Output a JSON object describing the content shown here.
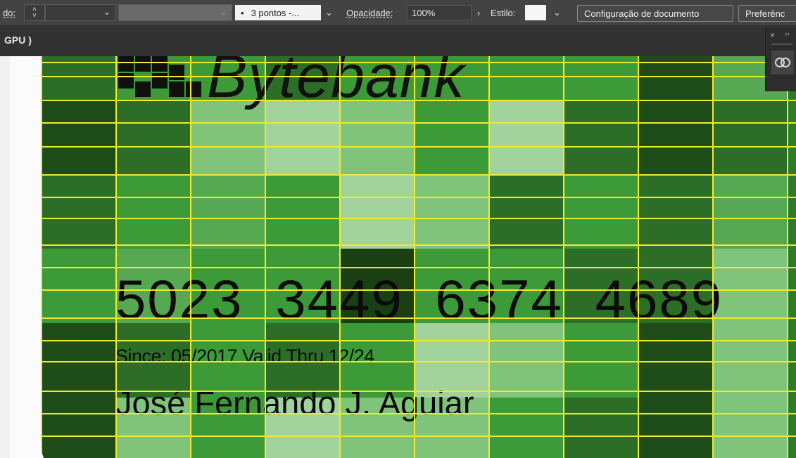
{
  "control_bar": {
    "left_fragment": "do:",
    "stroke_field_value": "",
    "brush_value": "3 pontos -...",
    "opacity_label": "Opacidade:",
    "opacity_value": "100%",
    "style_label": "Estilo:",
    "doc_settings_button": "Configuração de documento",
    "preferences_button": "Preferênc"
  },
  "tab": {
    "label": "GPU )"
  },
  "panel": {
    "close_glyph": "×",
    "collapse_glyph": "››"
  },
  "card": {
    "brand": "Bytebank",
    "number": "5023 3449 6374 4689",
    "dates": "Since: 05/2017 Valid Thru 12/24",
    "holder": "José Fernando J. Aguiar"
  },
  "colors": {
    "accent_grid": "#f2ea2c",
    "toolbar_bg": "#434343",
    "tabbar_bg": "#323232",
    "card_greens": [
      "#1e4d19",
      "#2c6e28",
      "#3c9b38",
      "#7fc47a",
      "#a3d39c",
      "#57a852"
    ]
  }
}
